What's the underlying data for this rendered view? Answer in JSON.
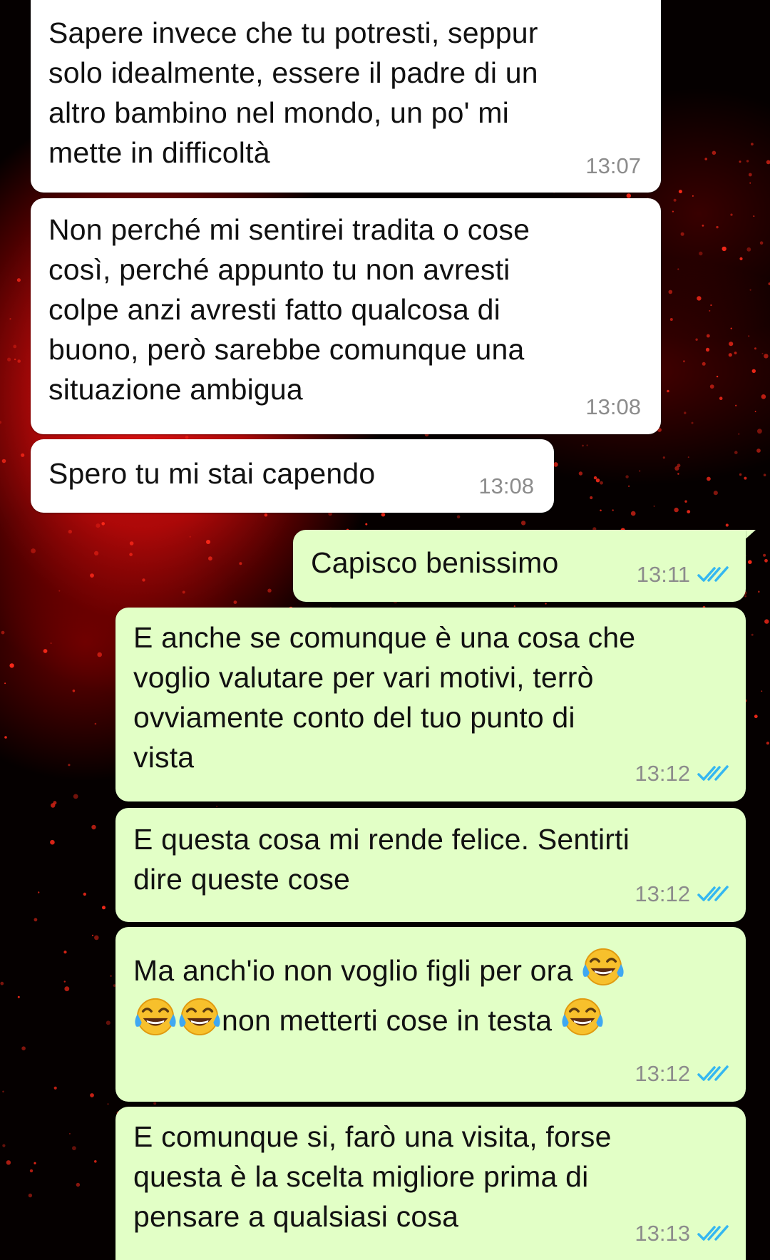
{
  "colors": {
    "incoming_bubble": "#ffffff",
    "outgoing_bubble": "#e2ffc6",
    "timestamp": "#8c8c8c",
    "read_ticks": "#34b7f1",
    "wallpaper_accent": "#e01010"
  },
  "messages": [
    {
      "direction": "incoming",
      "lines": [
        "Sapere invece che tu potresti, seppur",
        "solo idealmente, essere il padre di un",
        "altro bambino nel mondo, un po' mi",
        "mette in difficoltà"
      ],
      "time": "13:07"
    },
    {
      "direction": "incoming",
      "lines": [
        "Non perché mi sentirei tradita o cose",
        "così, perché appunto tu non avresti",
        "colpe anzi avresti fatto qualcosa di",
        "buono, però sarebbe comunque una",
        "situazione ambigua"
      ],
      "time": "13:08"
    },
    {
      "direction": "incoming",
      "lines": [
        "Spero tu mi stai capendo"
      ],
      "time": "13:08"
    },
    {
      "direction": "outgoing",
      "lines": [
        "Capisco benissimo"
      ],
      "time": "13:11",
      "status": "read"
    },
    {
      "direction": "outgoing",
      "lines": [
        "E anche se comunque è una cosa che",
        "voglio valutare per vari motivi, terrò",
        "ovviamente conto del tuo punto di",
        "vista"
      ],
      "time": "13:12",
      "status": "read"
    },
    {
      "direction": "outgoing",
      "lines": [
        "E questa cosa mi rende felice. Sentirti",
        "dire queste cose"
      ],
      "time": "13:12",
      "status": "read"
    },
    {
      "direction": "outgoing",
      "line1": "Ma anch'io non voglio figli per ora",
      "line2": "non metterti cose in testa",
      "emoji": "face-with-tears-of-joy-icon",
      "time": "13:12",
      "status": "read"
    },
    {
      "direction": "outgoing",
      "lines": [
        "E comunque si, farò una visita, forse",
        "questa è la scelta migliore prima di",
        "pensare a qualsiasi cosa"
      ],
      "time": "13:13",
      "status": "read"
    }
  ]
}
